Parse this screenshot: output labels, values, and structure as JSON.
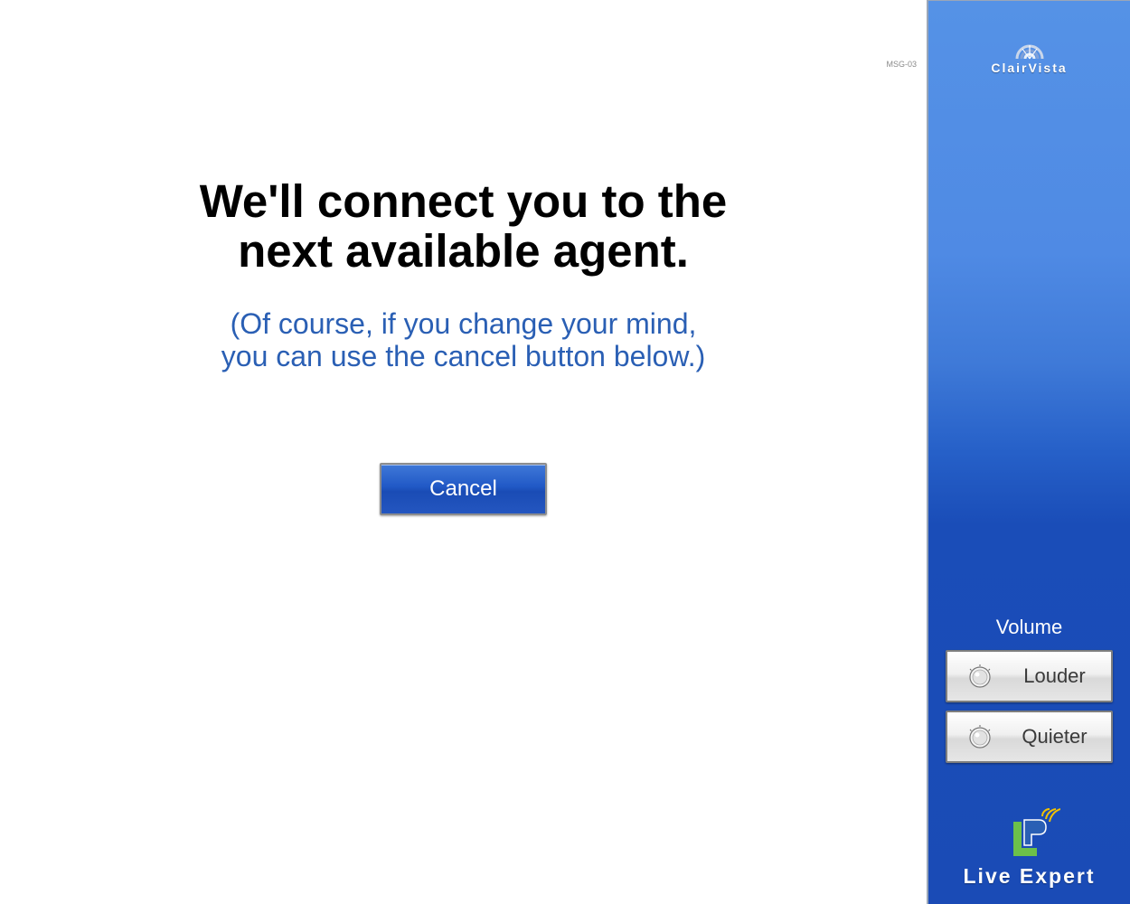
{
  "screen_code": "MSG-03",
  "message": {
    "headline_line1": "We'll connect you to the",
    "headline_line2": "next available agent.",
    "sub_line1": "(Of course, if you change your mind,",
    "sub_line2": "you can use the cancel button below.)"
  },
  "buttons": {
    "cancel_label": "Cancel"
  },
  "sidebar": {
    "brand_name": "ClairVista",
    "volume_label": "Volume",
    "louder_label": "Louder",
    "quieter_label": "Quieter",
    "louder_icon": "speaker-dial-icon",
    "quieter_icon": "speaker-dial-icon",
    "product_name": "Live Expert",
    "product_logo": "live-expert-logo"
  },
  "colors": {
    "sidebar_blue": "#2660c8",
    "subtext_blue": "#2a5fb4",
    "cancel_blue": "#2159c6",
    "logo_green": "#6cc04a"
  }
}
